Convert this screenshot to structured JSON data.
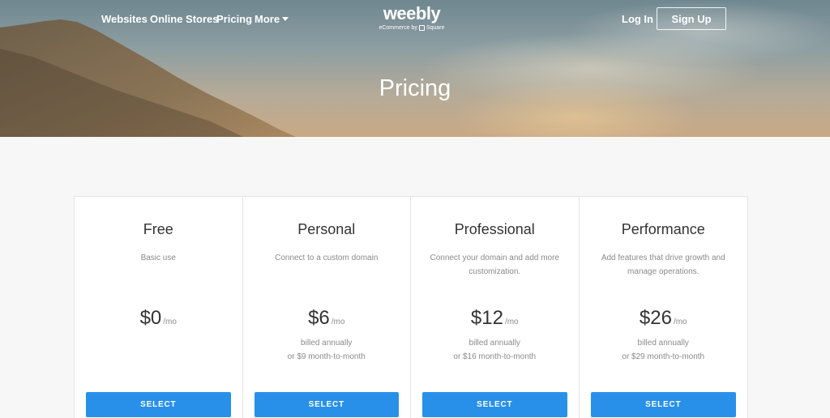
{
  "nav": {
    "links": [
      "Websites",
      "Online Stores",
      "Pricing",
      "More"
    ],
    "login": "Log In",
    "signup": "Sign Up"
  },
  "logo": {
    "word": "weebly",
    "tagline_prefix": "eCommerce by",
    "tagline_brand": "Square"
  },
  "hero": {
    "title": "Pricing"
  },
  "plans": [
    {
      "name": "Free",
      "description": "Basic use",
      "price": "$0",
      "per": "/mo",
      "billing_line1": "",
      "billing_line2": "",
      "button": "SELECT"
    },
    {
      "name": "Personal",
      "description": "Connect to a custom domain",
      "price": "$6",
      "per": "/mo",
      "billing_line1": "billed annually",
      "billing_line2": "or $9 month-to-month",
      "button": "SELECT"
    },
    {
      "name": "Professional",
      "description": "Connect your domain and add more customization.",
      "price": "$12",
      "per": "/mo",
      "billing_line1": "billed annually",
      "billing_line2": "or $16 month-to-month",
      "button": "SELECT"
    },
    {
      "name": "Performance",
      "description": "Add features that drive growth and manage operations.",
      "price": "$26",
      "per": "/mo",
      "billing_line1": "billed annually",
      "billing_line2": "or $29 month-to-month",
      "button": "SELECT"
    }
  ],
  "colors": {
    "accent": "#2990ea",
    "text_dark": "#333333",
    "text_muted": "#8a8a8a",
    "page_bg": "#f7f7f7"
  }
}
